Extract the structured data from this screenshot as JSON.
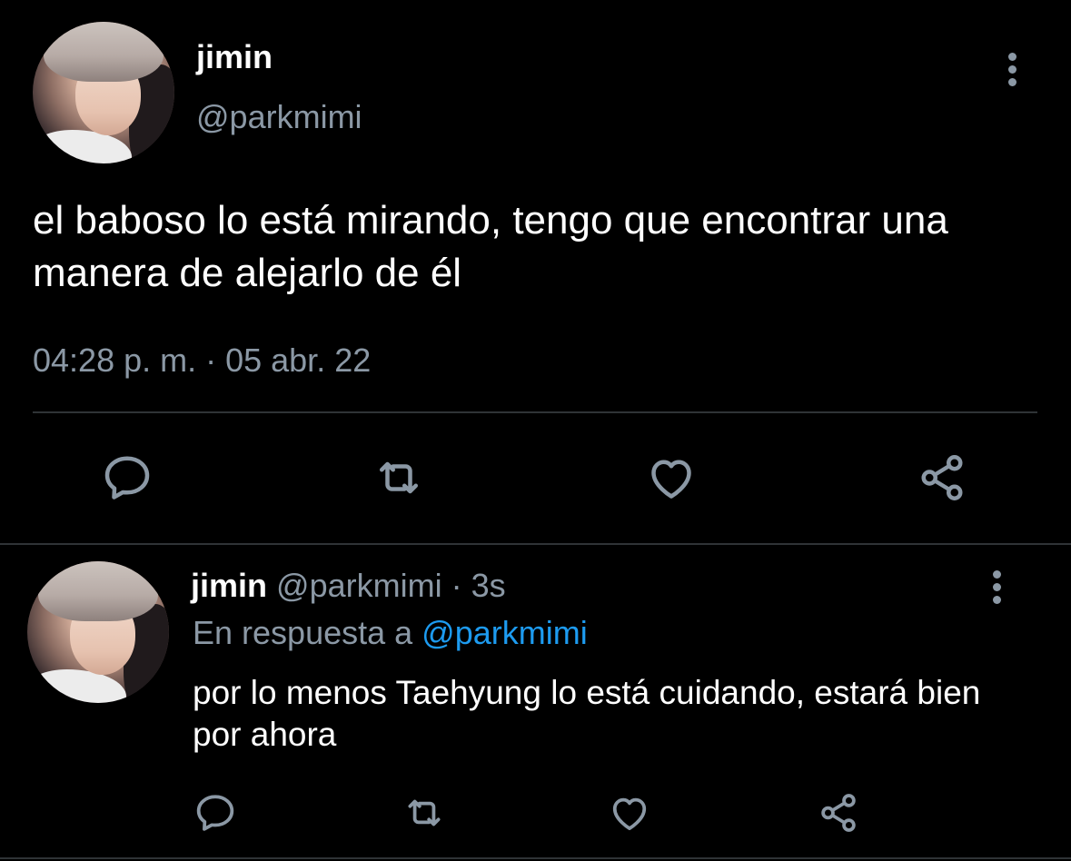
{
  "colors": {
    "background": "#000000",
    "primary_text": "#ffffff",
    "secondary_text": "#8b98a5",
    "link": "#1d9bf0",
    "divider": "#2f3336"
  },
  "main_tweet": {
    "display_name": "jimin",
    "handle": "@parkmimi",
    "text": "el baboso lo está mirando, tengo que encontrar una manera de alejarlo de él",
    "timestamp": "04:28 p. m. · 05 abr. 22",
    "actions": {
      "reply_icon": "reply-icon",
      "retweet_icon": "retweet-icon",
      "like_icon": "heart-icon",
      "share_icon": "share-icon"
    }
  },
  "reply_tweet": {
    "display_name": "jimin",
    "handle": "@parkmimi",
    "time_ago": "· 3s",
    "in_reply_prefix": "En respuesta a",
    "in_reply_mention": "@parkmimi",
    "text": "por lo menos Taehyung lo está cuidando, estará bien por ahora",
    "actions": {
      "reply_icon": "reply-icon",
      "retweet_icon": "retweet-icon",
      "like_icon": "heart-icon",
      "share_icon": "share-icon"
    }
  }
}
